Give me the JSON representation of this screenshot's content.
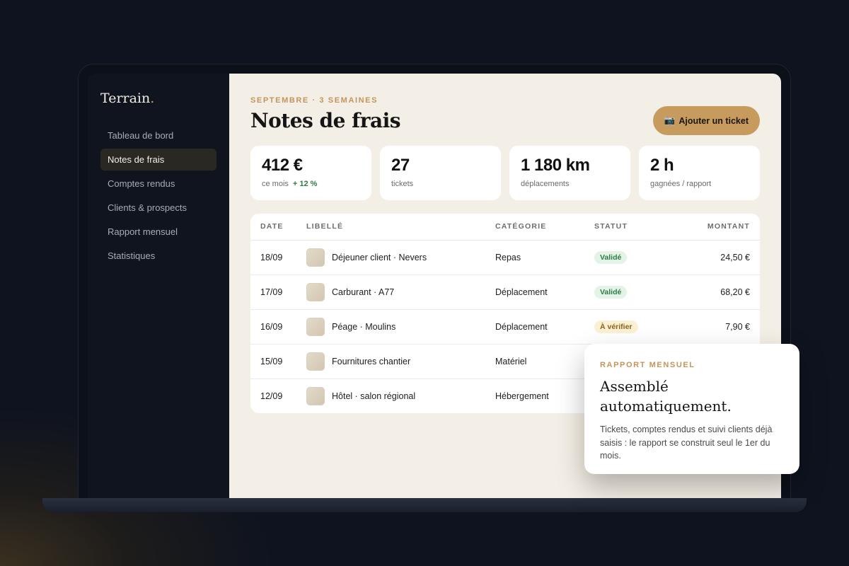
{
  "sidebar": {
    "brand": "Terrain",
    "brand_dot": ".",
    "items": [
      {
        "label": "Tableau de bord"
      },
      {
        "label": "Notes de frais",
        "active": true
      },
      {
        "label": "Comptes rendus"
      },
      {
        "label": "Clients & prospects"
      },
      {
        "label": "Rapport mensuel"
      },
      {
        "label": "Statistiques"
      }
    ]
  },
  "header": {
    "eyebrow": "SEPTEMBRE · 3 SEMAINES",
    "title": "Notes de frais",
    "add_button_icon": "📷",
    "add_button_label": "Ajouter un ticket"
  },
  "kpis": [
    {
      "value": "412 €",
      "label": "ce mois",
      "delta": "+ 12 %"
    },
    {
      "value": "27",
      "label": "tickets"
    },
    {
      "value": "1 180 km",
      "label": "déplacements"
    },
    {
      "value": "2 h",
      "label": "gagnées / rapport"
    }
  ],
  "table": {
    "columns": [
      "DATE",
      "LIBELLÉ",
      "CATÉGORIE",
      "STATUT",
      "MONTANT"
    ],
    "rows": [
      {
        "date": "18/09",
        "label": "Déjeuner client · Nevers",
        "category": "Repas",
        "status": "Validé",
        "amount": "24,50 €"
      },
      {
        "date": "17/09",
        "label": "Carburant · A77",
        "category": "Déplacement",
        "status": "Validé",
        "amount": "68,20 €"
      },
      {
        "date": "16/09",
        "label": "Péage · Moulins",
        "category": "Déplacement",
        "status": "À vérifier",
        "amount": "7,90 €"
      },
      {
        "date": "15/09",
        "label": "Fournitures chantier",
        "category": "Matériel",
        "status": "",
        "amount": ""
      },
      {
        "date": "12/09",
        "label": "Hôtel · salon régional",
        "category": "Hébergement",
        "status": "",
        "amount": ""
      }
    ]
  },
  "popover": {
    "eyebrow": "RAPPORT MENSUEL",
    "title_line1": "Assemblé",
    "title_line2": "automatiquement.",
    "text": "Tickets, comptes rendus et suivi clients déjà saisis : le rapport se construit seul le 1er du mois."
  },
  "colors": {
    "accent": "#c79b5e",
    "background": "#0e131f",
    "main_bg": "#f4efe6",
    "valid": "#2e7d45",
    "pending": "#8a6416"
  }
}
